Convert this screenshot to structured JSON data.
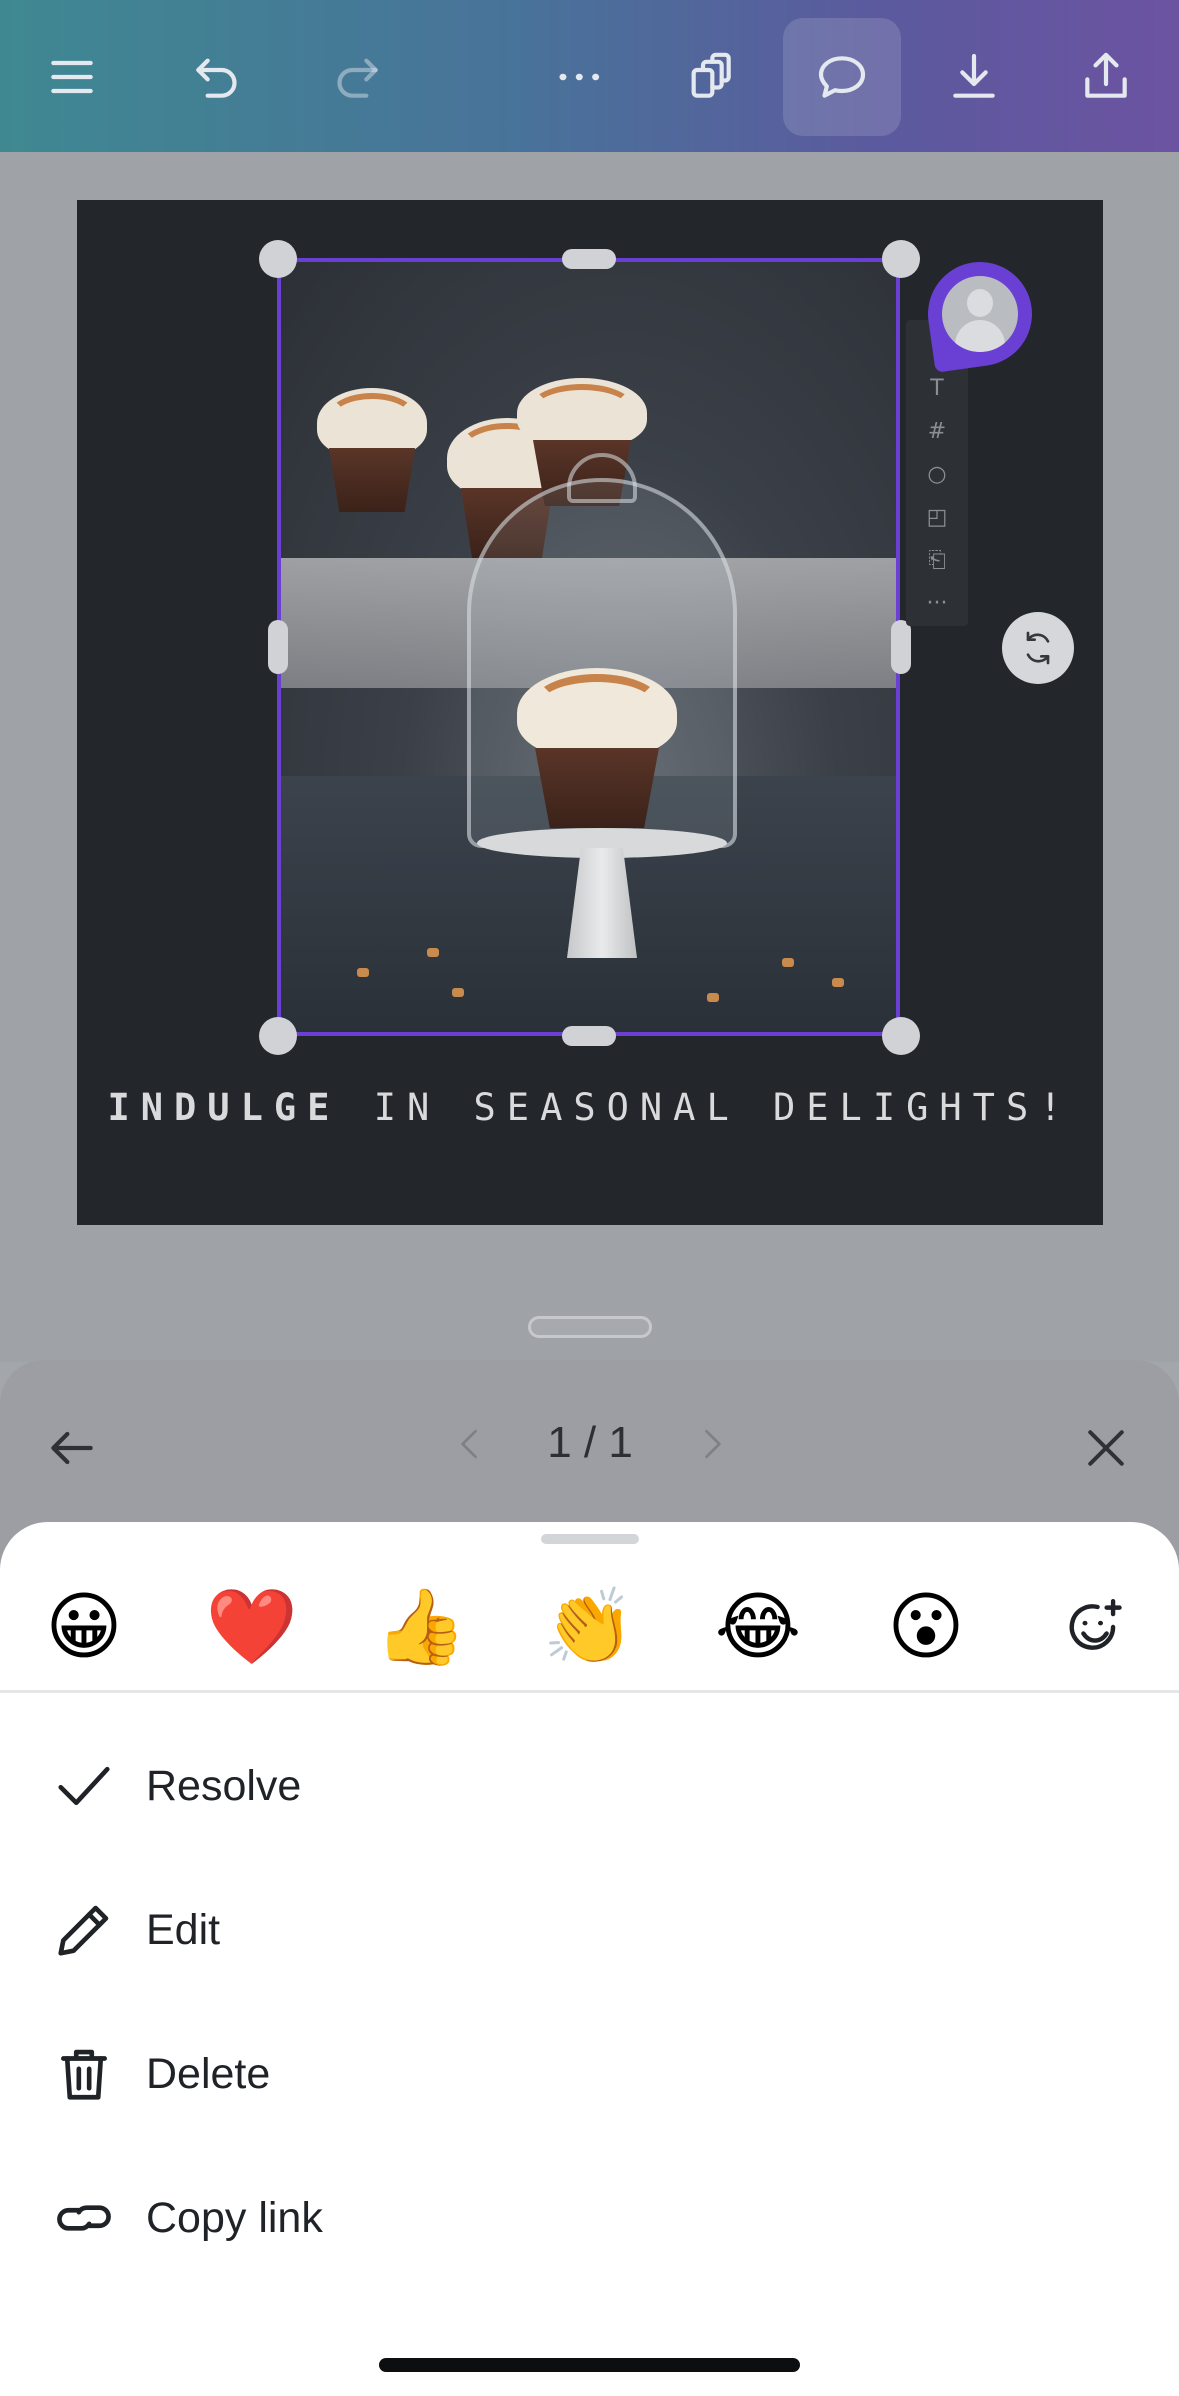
{
  "toolbar": {
    "icons": [
      "menu-icon",
      "undo-icon",
      "redo-icon",
      "more-icon",
      "pages-icon",
      "comment-icon",
      "download-icon",
      "share-icon"
    ],
    "active": "comment-icon"
  },
  "design": {
    "headline_bold": "INDULGE",
    "headline_rest": " IN SEASONAL DELIGHTS!",
    "side_tools": [
      "⌞",
      "T",
      "#",
      "○",
      "◰",
      "⎗",
      "···"
    ]
  },
  "comments_nav": {
    "page_indicator": "1 / 1"
  },
  "reactions": {
    "emojis": [
      "😀",
      "❤️",
      "👍",
      "👏",
      "😂",
      "😮"
    ]
  },
  "actions": {
    "resolve": "Resolve",
    "edit": "Edit",
    "delete": "Delete",
    "copy_link": "Copy link"
  },
  "colors": {
    "selection": "#6a3fd3",
    "toolbar_gradient_start": "#1e9aa5",
    "toolbar_gradient_end": "#6b3fc0"
  }
}
